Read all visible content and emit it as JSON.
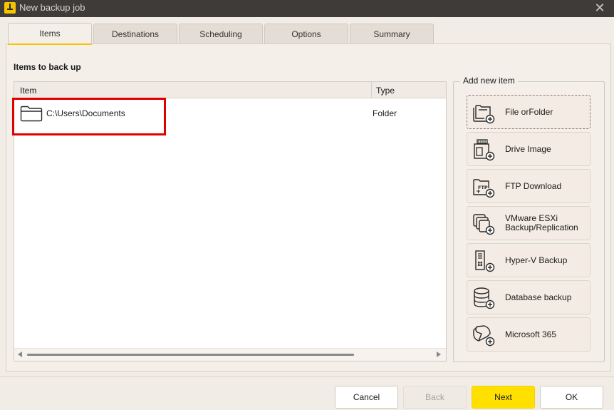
{
  "window": {
    "title": "New backup job",
    "close_glyph": "✕"
  },
  "tabs": [
    {
      "label": "Items",
      "active": true
    },
    {
      "label": "Destinations",
      "active": false
    },
    {
      "label": "Scheduling",
      "active": false
    },
    {
      "label": "Options",
      "active": false
    },
    {
      "label": "Summary",
      "active": false
    }
  ],
  "items_section": {
    "title": "Items to back up",
    "columns": {
      "item": "Item",
      "type": "Type"
    },
    "rows": [
      {
        "icon": "folder-icon",
        "path": "C:\\Users\\Documents",
        "type": "Folder"
      }
    ]
  },
  "add_new_item": {
    "label": "Add new item",
    "buttons": [
      {
        "label": "File orFolder",
        "icon": "file-folder-add-icon"
      },
      {
        "label": "Drive Image",
        "icon": "drive-image-add-icon"
      },
      {
        "label": "FTP Download",
        "icon": "ftp-download-add-icon",
        "icon_text": "FTP"
      },
      {
        "label": "VMware ESXi Backup/Replication",
        "line1": "VMware ESXi",
        "line2": "Backup/Replication",
        "icon": "vmware-add-icon"
      },
      {
        "label": "Hyper-V Backup",
        "icon": "hyperv-add-icon"
      },
      {
        "label": "Database backup",
        "icon": "database-add-icon"
      },
      {
        "label": "Microsoft 365",
        "icon": "microsoft365-add-icon"
      }
    ]
  },
  "footer": {
    "cancel": "Cancel",
    "back": "Back",
    "next": "Next",
    "ok": "OK"
  },
  "colors": {
    "accent": "#ffe000",
    "highlight": "#e00000",
    "titlebar": "#3f3b38"
  }
}
